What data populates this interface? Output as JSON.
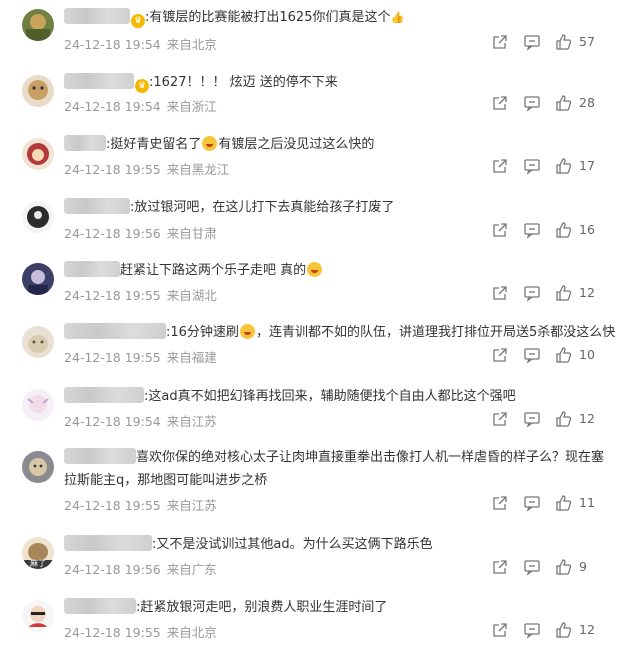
{
  "comments": [
    {
      "text": ":有镀层的比赛能被打出1625你们真是这个",
      "meta": {
        "time": "24-12-18 19:54",
        "location": "来自北京"
      },
      "likes": "57",
      "avatar_color": "#7a8a4a"
    },
    {
      "text": ":1627！！！ 炫迈 送的停不下来",
      "meta": {
        "time": "24-12-18 19:54",
        "location": "来自浙江"
      },
      "likes": "28",
      "avatar_color": "#c8a066"
    },
    {
      "text": ":挺好青史留名了",
      "text2": "有镀层之后没见过这么快的",
      "meta": {
        "time": "24-12-18 19:55",
        "location": "来自黑龙江"
      },
      "likes": "17",
      "avatar_color": "#b23a3a"
    },
    {
      "text": ":放过银河吧，在这儿打下去真能给孩子打废了",
      "meta": {
        "time": "24-12-18 19:56",
        "location": "来自甘肃"
      },
      "likes": "16",
      "avatar_color": "#2b2b2b"
    },
    {
      "text": "赶紧让下路这两个乐子走吧 真的",
      "meta": {
        "time": "24-12-18 19:55",
        "location": "来自湖北"
      },
      "likes": "12",
      "avatar_color": "#4a4d7a"
    },
    {
      "text": ":16分钟速刷",
      "text2": "，连青训都不如的队伍，讲道理我打排位开局送5杀都没这么快",
      "meta": {
        "time": "24-12-18 19:55",
        "location": "来自福建"
      },
      "likes": "10",
      "avatar_color": "#d9cbb0"
    },
    {
      "text": ":这ad真不如把幻锋再找回来，辅助随便找个自由人都比这个强吧",
      "meta": {
        "time": "24-12-18 19:54",
        "location": "来自江苏"
      },
      "likes": "12",
      "avatar_color": "#e7dfe9"
    },
    {
      "text": "喜欢你保的绝对核心太子让肉坤直接重拳出击像打人机一样虐昏的样子么？现在塞",
      "text_line2": "拉斯能主q，那地图可能叫进步之桥",
      "meta": {
        "time": "24-12-18 19:55",
        "location": "来自江苏"
      },
      "likes": "11",
      "avatar_color": "#8a8a90"
    },
    {
      "text": ":又不是没试训过其他ad。为什么买这俩下路乐色",
      "meta": {
        "time": "24-12-18 19:56",
        "location": "来自广东"
      },
      "likes": "9",
      "avatar_color": "#a8865a",
      "avatar_text": "麻了"
    },
    {
      "text": ":赶紧放银河走吧，别浪费人职业生涯时间了",
      "meta": {
        "time": "24-12-18 19:55",
        "location": "来自北京"
      },
      "likes": "12",
      "avatar_color": "#d33a3a"
    }
  ]
}
